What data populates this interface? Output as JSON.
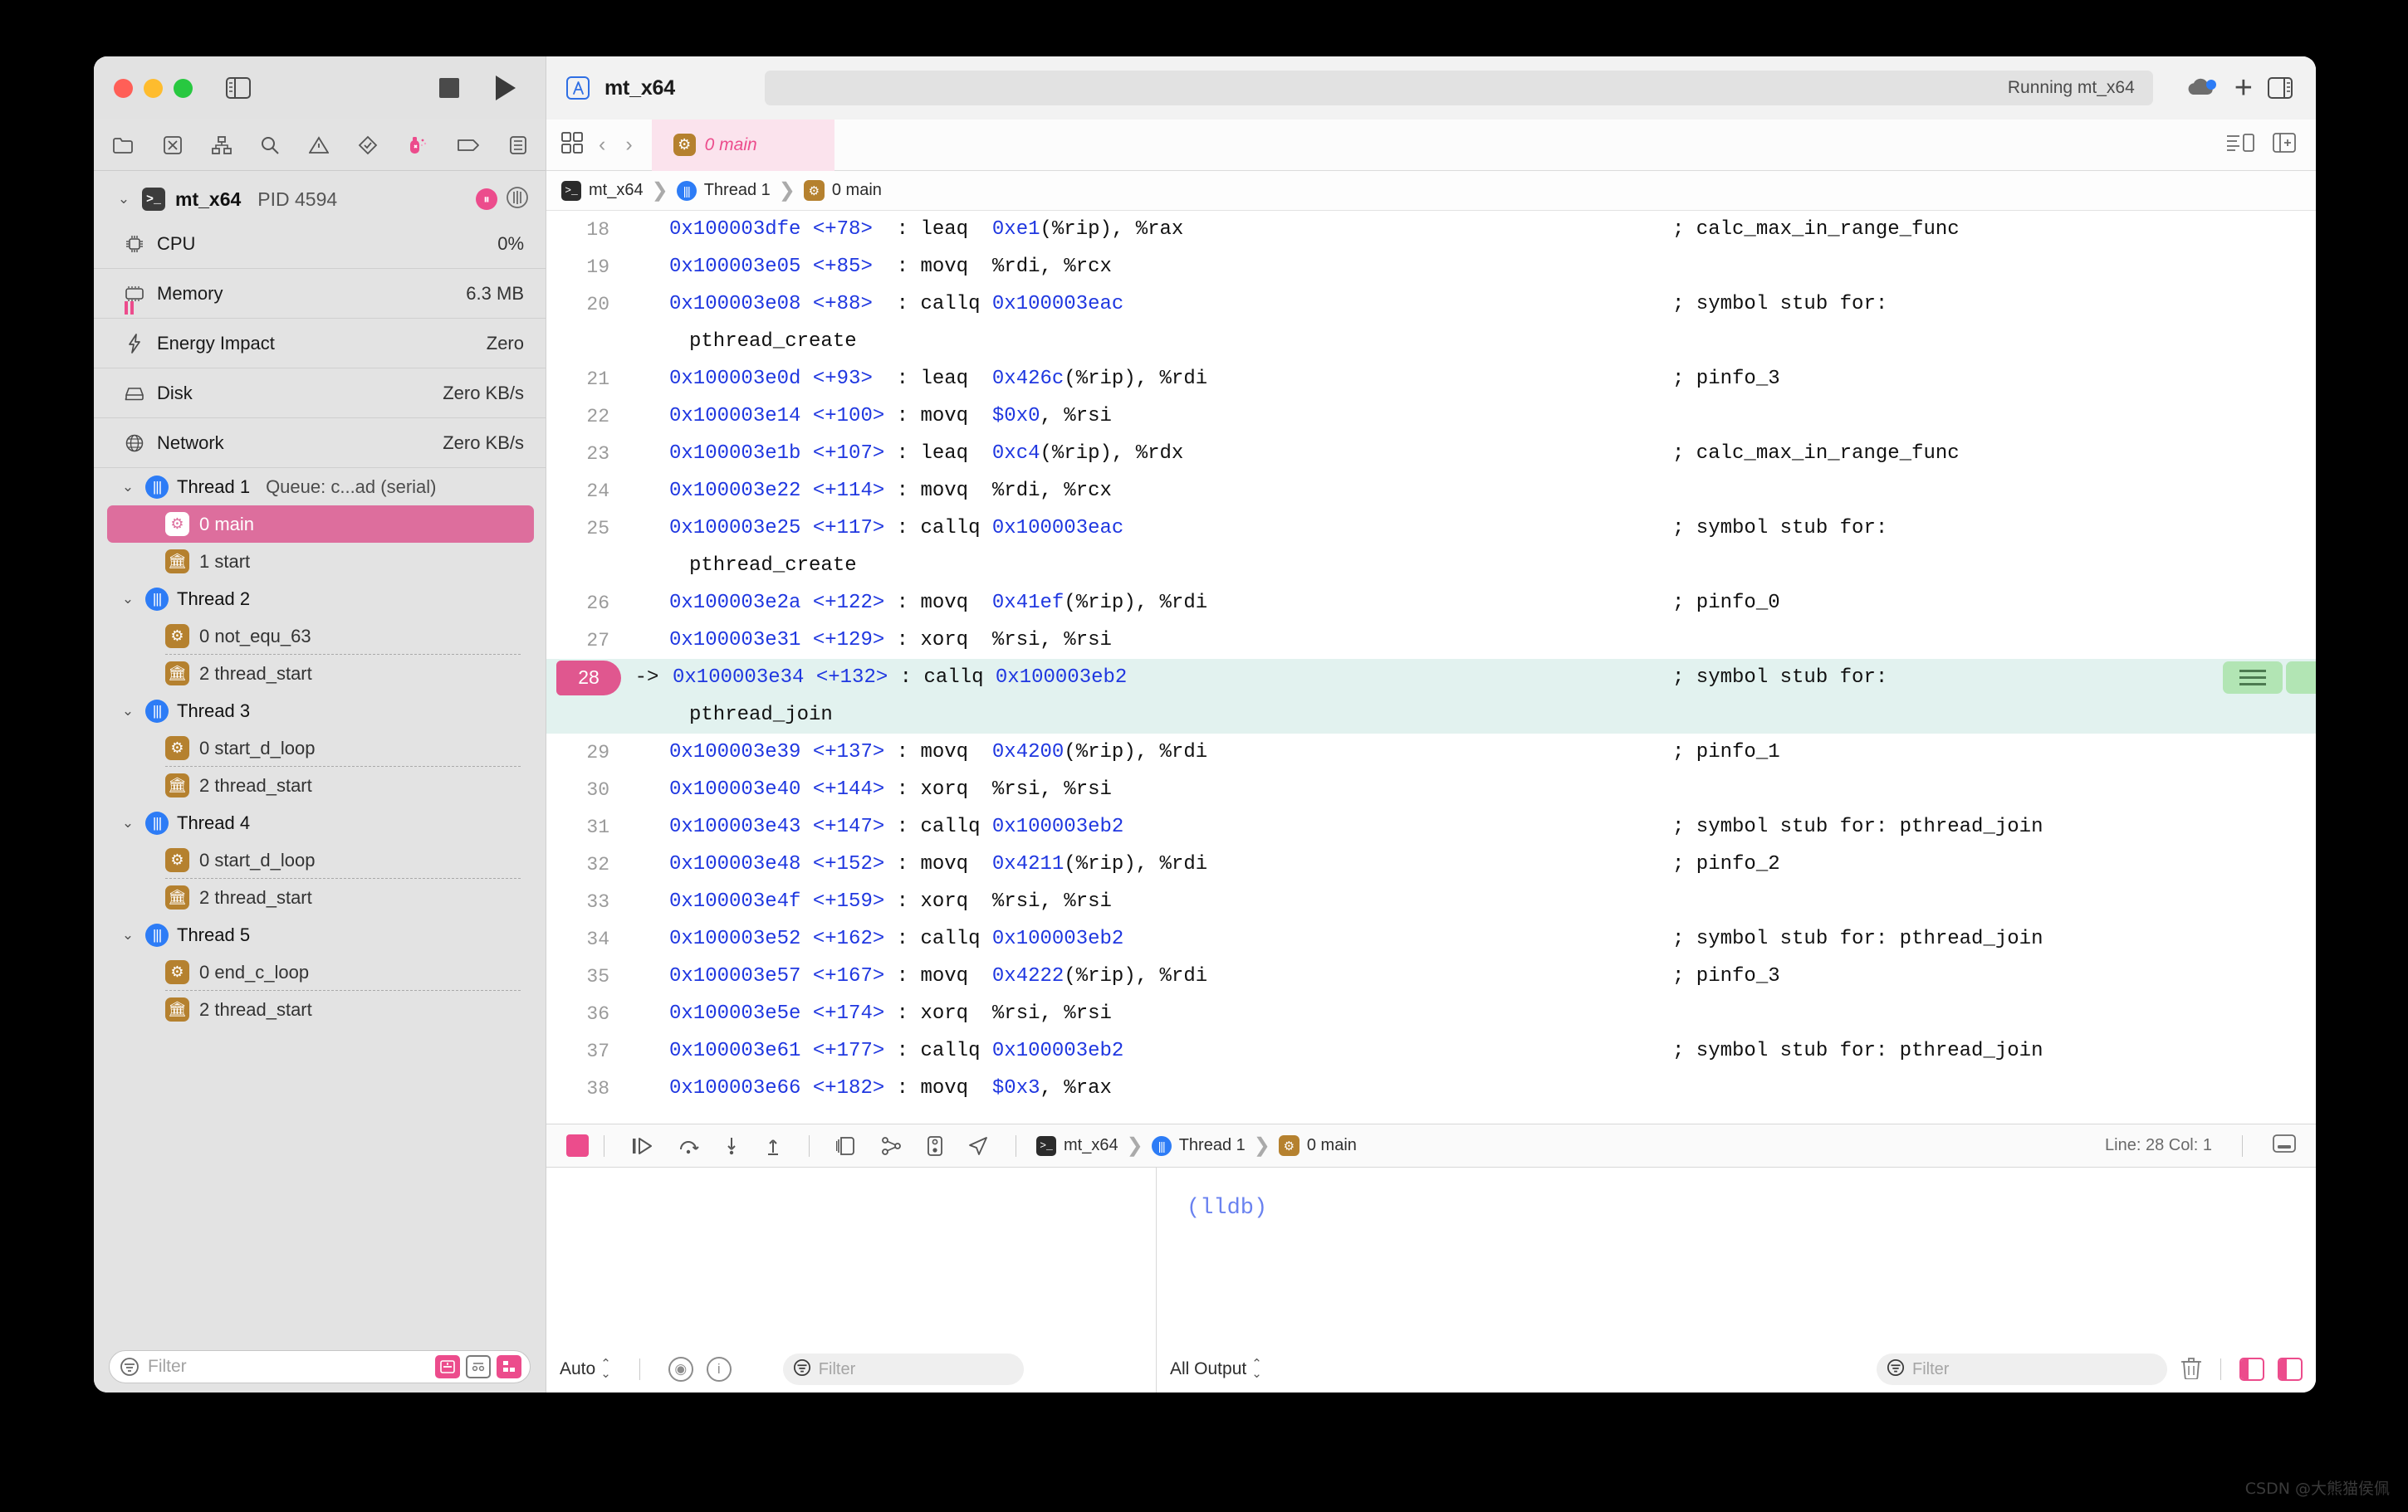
{
  "window": {
    "scheme_name": "mt_x64",
    "activity_status": "Running mt_x64",
    "traffic_lights": [
      "close",
      "minimize",
      "zoom"
    ]
  },
  "navigator": {
    "icon_bar": [
      "folder-icon",
      "source-control-icon",
      "hierarchy-icon",
      "search-icon",
      "warning-icon",
      "test-icon",
      "debug-icon",
      "breakpoint-icon",
      "report-icon"
    ],
    "process": {
      "name": "mt_x64",
      "pid_label": "PID 4594"
    },
    "gauges": [
      {
        "label": "CPU",
        "value": "0%",
        "icon": "cpu-icon"
      },
      {
        "label": "Memory",
        "value": "6.3 MB",
        "icon": "memory-icon"
      },
      {
        "label": "Energy Impact",
        "value": "Zero",
        "icon": "energy-icon"
      },
      {
        "label": "Disk",
        "value": "Zero KB/s",
        "icon": "disk-icon"
      },
      {
        "label": "Network",
        "value": "Zero KB/s",
        "icon": "network-icon"
      }
    ],
    "threads": [
      {
        "label": "Thread 1",
        "queue": "Queue: c...ad (serial)",
        "frames": [
          {
            "label": "0 main",
            "kind": "user",
            "selected": true
          },
          {
            "label": "1 start",
            "kind": "system",
            "selected": false
          }
        ]
      },
      {
        "label": "Thread 2",
        "queue": "",
        "frames": [
          {
            "label": "0 not_equ_63",
            "kind": "user",
            "selected": false
          },
          {
            "label": "2 thread_start",
            "kind": "system",
            "selected": false
          }
        ]
      },
      {
        "label": "Thread 3",
        "queue": "",
        "frames": [
          {
            "label": "0 start_d_loop",
            "kind": "user",
            "selected": false
          },
          {
            "label": "2 thread_start",
            "kind": "system",
            "selected": false
          }
        ]
      },
      {
        "label": "Thread 4",
        "queue": "",
        "frames": [
          {
            "label": "0 start_d_loop",
            "kind": "user",
            "selected": false
          },
          {
            "label": "2 thread_start",
            "kind": "system",
            "selected": false
          }
        ]
      },
      {
        "label": "Thread 5",
        "queue": "",
        "frames": [
          {
            "label": "0 end_c_loop",
            "kind": "user",
            "selected": false
          },
          {
            "label": "2 thread_start",
            "kind": "system",
            "selected": false
          }
        ]
      }
    ],
    "filter_placeholder": "Filter"
  },
  "editor": {
    "tab_label": "0 main",
    "breadcrumb": [
      "mt_x64",
      "Thread 1",
      "0 main"
    ],
    "line_col": "Line: 28  Col: 1"
  },
  "disassembly": {
    "lines": [
      {
        "num": "18",
        "current": false,
        "addr": "0x100003dfe",
        "off": "<+78>",
        "mnem": "leaq",
        "oper_hex": "0xe1",
        "oper_rest": "(%rip), %rax",
        "comment": "; calc_max_in_range_func",
        "cont": ""
      },
      {
        "num": "19",
        "current": false,
        "addr": "0x100003e05",
        "off": "<+85>",
        "mnem": "movq",
        "oper_hex": "",
        "oper_rest": "%rdi, %rcx",
        "comment": "",
        "cont": ""
      },
      {
        "num": "20",
        "current": false,
        "addr": "0x100003e08",
        "off": "<+88>",
        "mnem": "callq",
        "oper_hex": "0x100003eac",
        "oper_rest": "",
        "comment": "; symbol stub for:",
        "cont": "pthread_create"
      },
      {
        "num": "21",
        "current": false,
        "addr": "0x100003e0d",
        "off": "<+93>",
        "mnem": "leaq",
        "oper_hex": "0x426c",
        "oper_rest": "(%rip), %rdi",
        "comment": "; pinfo_3",
        "cont": ""
      },
      {
        "num": "22",
        "current": false,
        "addr": "0x100003e14",
        "off": "<+100>",
        "mnem": "movq",
        "oper_hex": "$0x0",
        "oper_rest": ", %rsi",
        "comment": "",
        "cont": ""
      },
      {
        "num": "23",
        "current": false,
        "addr": "0x100003e1b",
        "off": "<+107>",
        "mnem": "leaq",
        "oper_hex": "0xc4",
        "oper_rest": "(%rip), %rdx",
        "comment": "; calc_max_in_range_func",
        "cont": ""
      },
      {
        "num": "24",
        "current": false,
        "addr": "0x100003e22",
        "off": "<+114>",
        "mnem": "movq",
        "oper_hex": "",
        "oper_rest": "%rdi, %rcx",
        "comment": "",
        "cont": ""
      },
      {
        "num": "25",
        "current": false,
        "addr": "0x100003e25",
        "off": "<+117>",
        "mnem": "callq",
        "oper_hex": "0x100003eac",
        "oper_rest": "",
        "comment": "; symbol stub for:",
        "cont": "pthread_create"
      },
      {
        "num": "26",
        "current": false,
        "addr": "0x100003e2a",
        "off": "<+122>",
        "mnem": "movq",
        "oper_hex": "0x41ef",
        "oper_rest": "(%rip), %rdi",
        "comment": "; pinfo_0",
        "cont": ""
      },
      {
        "num": "27",
        "current": false,
        "addr": "0x100003e31",
        "off": "<+129>",
        "mnem": "xorq",
        "oper_hex": "",
        "oper_rest": "%rsi, %rsi",
        "comment": "",
        "cont": ""
      },
      {
        "num": "28",
        "current": true,
        "arrow": "->",
        "addr": "0x100003e34",
        "off": "<+132>",
        "mnem": "callq",
        "oper_hex": "0x100003eb2",
        "oper_rest": "",
        "comment": "; symbol stub for:",
        "cont": "pthread_join"
      },
      {
        "num": "29",
        "current": false,
        "addr": "0x100003e39",
        "off": "<+137>",
        "mnem": "movq",
        "oper_hex": "0x4200",
        "oper_rest": "(%rip), %rdi",
        "comment": "; pinfo_1",
        "cont": ""
      },
      {
        "num": "30",
        "current": false,
        "addr": "0x100003e40",
        "off": "<+144>",
        "mnem": "xorq",
        "oper_hex": "",
        "oper_rest": "%rsi, %rsi",
        "comment": "",
        "cont": ""
      },
      {
        "num": "31",
        "current": false,
        "addr": "0x100003e43",
        "off": "<+147>",
        "mnem": "callq",
        "oper_hex": "0x100003eb2",
        "oper_rest": "",
        "comment": "; symbol stub for: pthread_join",
        "cont": ""
      },
      {
        "num": "32",
        "current": false,
        "addr": "0x100003e48",
        "off": "<+152>",
        "mnem": "movq",
        "oper_hex": "0x4211",
        "oper_rest": "(%rip), %rdi",
        "comment": "; pinfo_2",
        "cont": ""
      },
      {
        "num": "33",
        "current": false,
        "addr": "0x100003e4f",
        "off": "<+159>",
        "mnem": "xorq",
        "oper_hex": "",
        "oper_rest": "%rsi, %rsi",
        "comment": "",
        "cont": ""
      },
      {
        "num": "34",
        "current": false,
        "addr": "0x100003e52",
        "off": "<+162>",
        "mnem": "callq",
        "oper_hex": "0x100003eb2",
        "oper_rest": "",
        "comment": "; symbol stub for: pthread_join",
        "cont": ""
      },
      {
        "num": "35",
        "current": false,
        "addr": "0x100003e57",
        "off": "<+167>",
        "mnem": "movq",
        "oper_hex": "0x4222",
        "oper_rest": "(%rip), %rdi",
        "comment": "; pinfo_3",
        "cont": ""
      },
      {
        "num": "36",
        "current": false,
        "addr": "0x100003e5e",
        "off": "<+174>",
        "mnem": "xorq",
        "oper_hex": "",
        "oper_rest": "%rsi, %rsi",
        "comment": "",
        "cont": ""
      },
      {
        "num": "37",
        "current": false,
        "addr": "0x100003e61",
        "off": "<+177>",
        "mnem": "callq",
        "oper_hex": "0x100003eb2",
        "oper_rest": "",
        "comment": "; symbol stub for: pthread_join",
        "cont": ""
      },
      {
        "num": "38",
        "current": false,
        "addr": "0x100003e66",
        "off": "<+182>",
        "mnem": "movq",
        "oper_hex": "$0x3",
        "oper_rest": ", %rax",
        "comment": "",
        "cont": ""
      }
    ]
  },
  "debug_bar": {
    "buttons": [
      "stop-button",
      "continue-button",
      "step-over-button",
      "step-into-button",
      "step-out-button",
      "view-hierarchy-button",
      "memory-graph-button",
      "simulate-location-button",
      "environment-overrides-button"
    ]
  },
  "variables_pane": {
    "scope_label": "Auto",
    "filter_placeholder": "Filter"
  },
  "console_pane": {
    "prompt": "(lldb)",
    "output_filter_label": "All Output",
    "filter_placeholder": "Filter"
  },
  "watermark": "CSDN @大熊猫侯佩",
  "colors": {
    "accent_pink": "#ec4c8c",
    "selected_row": "#dd6e9d",
    "current_line_bg": "#e2f2ef",
    "addr_blue": "#1f37e0",
    "thread_blue": "#2d7cf6",
    "frame_gold": "#b5812f",
    "green_badge": "#b2e5b4"
  }
}
